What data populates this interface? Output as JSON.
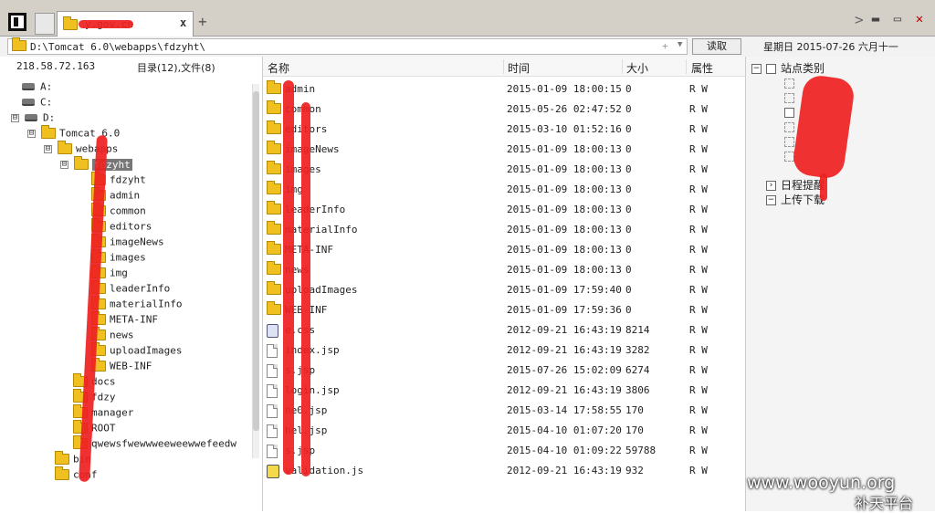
{
  "tab": {
    "title": "y.gov.cn",
    "close_label": "x",
    "new_tab_label": "+"
  },
  "address": {
    "path": "D:\\Tomcat 6.0\\webapps\\fdzyht\\",
    "plus": "+",
    "read_button": "读取",
    "date": "星期日 2015-07-26 六月十一"
  },
  "left": {
    "ip": "218.58.72.163",
    "summary": "目录(12),文件(8)",
    "tree": [
      {
        "label": "A:",
        "kind": "drive",
        "toggle": ""
      },
      {
        "label": "C:",
        "kind": "drive",
        "toggle": ""
      },
      {
        "label": "D:",
        "kind": "drive",
        "toggle": "⊟"
      },
      {
        "label": "Tomcat 6.0",
        "kind": "folder",
        "toggle": "⊟"
      },
      {
        "label": "webapps",
        "kind": "folder",
        "toggle": "⊟"
      },
      {
        "label": "fdzyht",
        "kind": "folder",
        "toggle": "⊟",
        "selected": true
      },
      {
        "label": "fdzyht",
        "kind": "folder",
        "toggle": ""
      },
      {
        "label": "admin",
        "kind": "folder",
        "toggle": ""
      },
      {
        "label": "common",
        "kind": "folder",
        "toggle": ""
      },
      {
        "label": "editors",
        "kind": "folder",
        "toggle": ""
      },
      {
        "label": "imageNews",
        "kind": "folder",
        "toggle": ""
      },
      {
        "label": "images",
        "kind": "folder",
        "toggle": ""
      },
      {
        "label": "img",
        "kind": "folder",
        "toggle": ""
      },
      {
        "label": "leaderInfo",
        "kind": "folder",
        "toggle": ""
      },
      {
        "label": "materialInfo",
        "kind": "folder",
        "toggle": ""
      },
      {
        "label": "META-INF",
        "kind": "folder",
        "toggle": ""
      },
      {
        "label": "news",
        "kind": "folder",
        "toggle": ""
      },
      {
        "label": "uploadImages",
        "kind": "folder",
        "toggle": ""
      },
      {
        "label": "WEB-INF",
        "kind": "folder",
        "toggle": ""
      },
      {
        "label": "docs",
        "kind": "folder",
        "toggle": ""
      },
      {
        "label": "fdzy",
        "kind": "folder",
        "toggle": ""
      },
      {
        "label": "manager",
        "kind": "folder",
        "toggle": ""
      },
      {
        "label": "ROOT",
        "kind": "folder",
        "toggle": ""
      },
      {
        "label": "qwewsfwewwweeweewwefeedw",
        "kind": "folder",
        "toggle": ""
      },
      {
        "label": "bin",
        "kind": "folder",
        "toggle": ""
      },
      {
        "label": "conf",
        "kind": "folder",
        "toggle": ""
      }
    ]
  },
  "list": {
    "headers": {
      "name": "名称",
      "time": "时间",
      "size": "大小",
      "attr": "属性"
    },
    "rows": [
      {
        "name": "admin",
        "time": "2015-01-09 18:00:15",
        "size": "0",
        "attr": "R W",
        "icon": "folder"
      },
      {
        "name": "common",
        "time": "2015-05-26 02:47:52",
        "size": "0",
        "attr": "R W",
        "icon": "folder"
      },
      {
        "name": "editors",
        "time": "2015-03-10 01:52:16",
        "size": "0",
        "attr": "R W",
        "icon": "folder"
      },
      {
        "name": "imageNews",
        "time": "2015-01-09 18:00:13",
        "size": "0",
        "attr": "R W",
        "icon": "folder"
      },
      {
        "name": "images",
        "time": "2015-01-09 18:00:13",
        "size": "0",
        "attr": "R W",
        "icon": "folder"
      },
      {
        "name": "img",
        "time": "2015-01-09 18:00:13",
        "size": "0",
        "attr": "R W",
        "icon": "folder"
      },
      {
        "name": "leaderInfo",
        "time": "2015-01-09 18:00:13",
        "size": "0",
        "attr": "R W",
        "icon": "folder"
      },
      {
        "name": "materialInfo",
        "time": "2015-01-09 18:00:13",
        "size": "0",
        "attr": "R W",
        "icon": "folder"
      },
      {
        "name": "META-INF",
        "time": "2015-01-09 18:00:13",
        "size": "0",
        "attr": "R W",
        "icon": "folder"
      },
      {
        "name": "news",
        "time": "2015-01-09 18:00:13",
        "size": "0",
        "attr": "R W",
        "icon": "folder"
      },
      {
        "name": "uploadImages",
        "time": "2015-01-09 17:59:40",
        "size": "0",
        "attr": "R W",
        "icon": "folder"
      },
      {
        "name": "WEB-INF",
        "time": "2015-01-09 17:59:36",
        "size": "0",
        "attr": "R W",
        "icon": "folder"
      },
      {
        "name": "e.css",
        "time": "2012-09-21 16:43:19",
        "size": "8214",
        "attr": "R W",
        "icon": "css"
      },
      {
        "name": "index.jsp",
        "time": "2012-09-21 16:43:19",
        "size": "3282",
        "attr": "R W",
        "icon": "doc"
      },
      {
        "name": "s.jsp",
        "time": "2015-07-26 15:02:09",
        "size": "6274",
        "attr": "R W",
        "icon": "doc"
      },
      {
        "name": "login.jsp",
        "time": "2012-09-21 16:43:19",
        "size": "3806",
        "attr": "R W",
        "icon": "doc"
      },
      {
        "name": "ne0.jsp",
        "time": "2015-03-14 17:58:55",
        "size": "170",
        "attr": "R W",
        "icon": "doc"
      },
      {
        "name": "hel.jsp",
        "time": "2015-04-10 01:07:20",
        "size": "170",
        "attr": "R W",
        "icon": "doc"
      },
      {
        "name": "s.jsp",
        "time": "2015-04-10 01:09:22",
        "size": "59788",
        "attr": "R W",
        "icon": "doc"
      },
      {
        "name": "validation.js",
        "time": "2012-09-21 16:43:19",
        "size": "932",
        "attr": "R W",
        "icon": "js"
      }
    ]
  },
  "right": {
    "category": "站点类别",
    "schedule": "日程提醒",
    "upload": "上传下载"
  },
  "watermark": {
    "site": "www.wooyun.org",
    "sub": "补天平台"
  }
}
